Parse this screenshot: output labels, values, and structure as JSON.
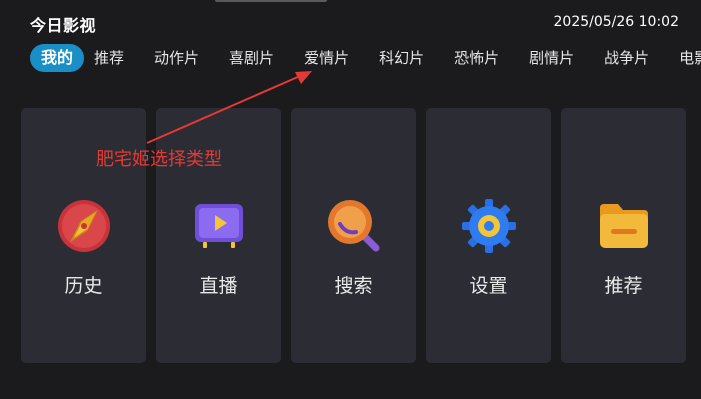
{
  "header": {
    "app_title": "今日影视",
    "datetime": "2025/05/26 10:02"
  },
  "tabs": [
    {
      "label": "我的",
      "active": true
    },
    {
      "label": "推荐"
    },
    {
      "label": "动作片"
    },
    {
      "label": "喜剧片"
    },
    {
      "label": "爱情片"
    },
    {
      "label": "科幻片"
    },
    {
      "label": "恐怖片"
    },
    {
      "label": "剧情片"
    },
    {
      "label": "战争片"
    },
    {
      "label": "电影解说"
    }
  ],
  "cards": [
    {
      "label": "历史",
      "icon": "history-compass-icon"
    },
    {
      "label": "直播",
      "icon": "live-tv-icon"
    },
    {
      "label": "搜索",
      "icon": "search-magnifier-icon"
    },
    {
      "label": "设置",
      "icon": "settings-gear-icon"
    },
    {
      "label": "推荐",
      "icon": "recommend-folder-icon"
    }
  ],
  "annotation": {
    "text": "肥宅姬选择类型",
    "color": "#e53935"
  },
  "colors": {
    "background": "#1b1b1d",
    "card": "#2c2d34",
    "accent_tab": "#1a8fc7"
  }
}
